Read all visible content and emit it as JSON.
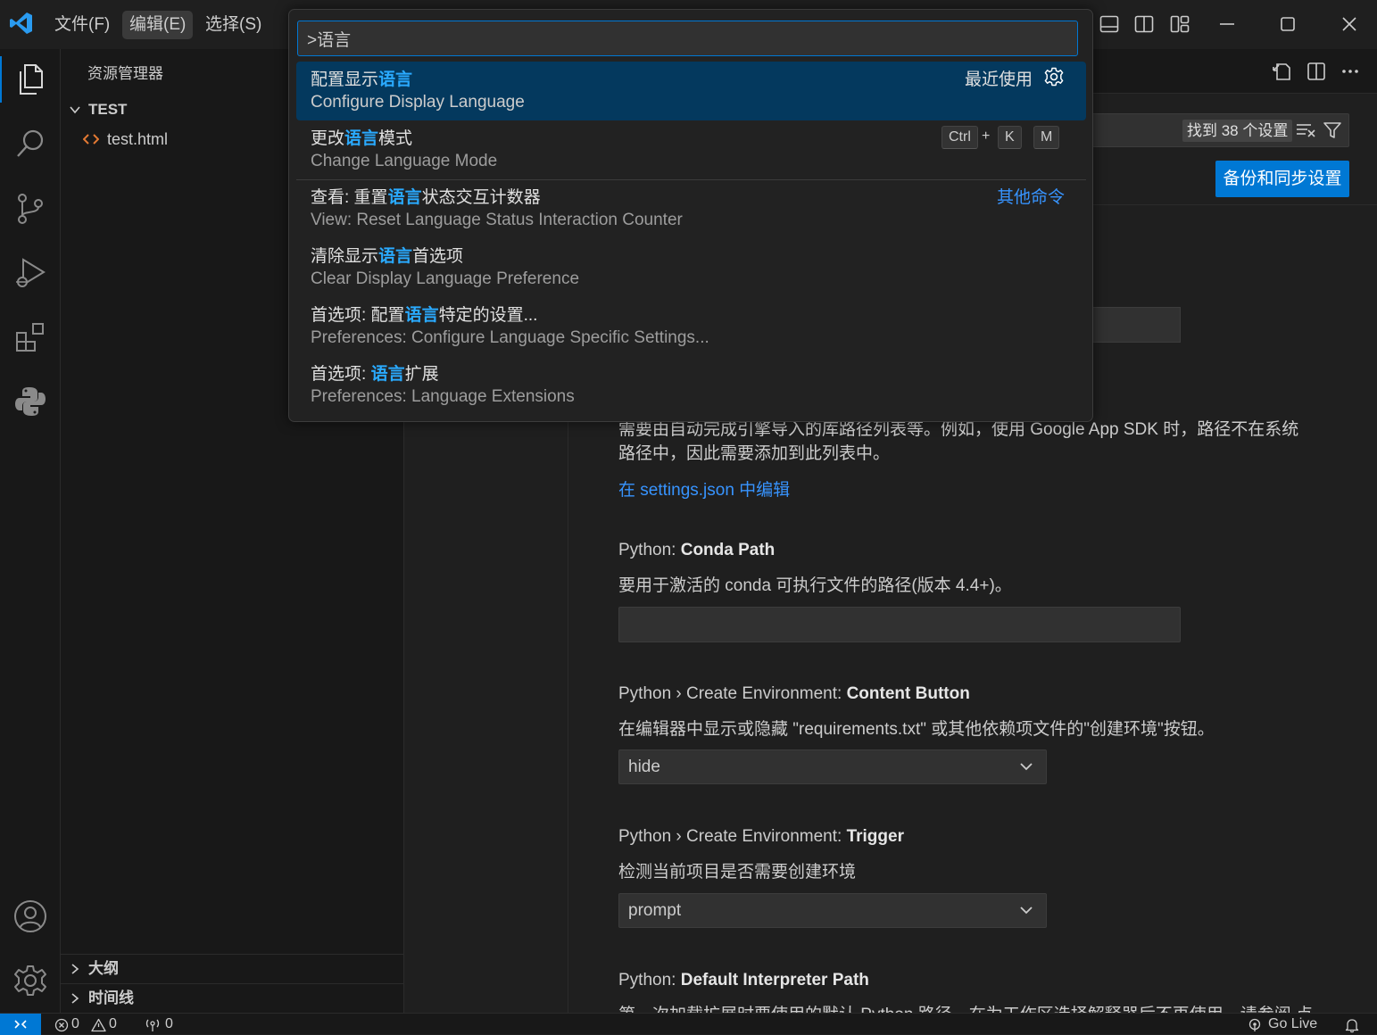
{
  "titlebar": {
    "menu": [
      "文件(F)",
      "编辑(E)",
      "选择(S)"
    ],
    "window_controls": [
      "minimize-icon",
      "maximize-icon",
      "close-icon"
    ],
    "layout_icons": [
      "toggle-panel-icon",
      "toggle-sidebar-icon",
      "customize-layout-icon"
    ]
  },
  "activity_bar": [
    "explorer-icon",
    "search-icon",
    "source-control-icon",
    "run-debug-icon",
    "extensions-icon",
    "python-icon",
    "account-icon",
    "manage-gear-icon"
  ],
  "sidebar": {
    "title": "资源管理器",
    "folder": "TEST",
    "files": [
      {
        "name": "test.html",
        "icon": "html-file-icon"
      }
    ],
    "panels": [
      "大纲",
      "时间线"
    ]
  },
  "palette": {
    "input_value": ">语言",
    "items": [
      {
        "label_pre": "配置显示",
        "label_hl": "语言",
        "label_post": "",
        "detail": "Configure Display Language",
        "right_text": "最近使用"
      },
      {
        "label_pre": "更改",
        "label_hl": "语言",
        "label_post": "模式",
        "detail": "Change Language Mode",
        "keys": [
          "Ctrl",
          "+",
          "K",
          "M"
        ]
      },
      {
        "label_pre": "查看: 重置",
        "label_hl": "语言",
        "label_post": "状态交互计数器",
        "detail": "View: Reset Language Status Interaction Counter",
        "right_text": "其他命令"
      },
      {
        "label_pre": "清除显示",
        "label_hl": "语言",
        "label_post": "首选项",
        "detail": "Clear Display Language Preference"
      },
      {
        "label_pre": "首选项: 配置",
        "label_hl": "语言",
        "label_post": "特定的设置...",
        "detail": "Preferences: Configure Language Specific Settings..."
      },
      {
        "label_pre": "首选项: ",
        "label_hl": "语言",
        "label_post": "扩展",
        "detail": "Preferences: Language Extensions"
      }
    ]
  },
  "settings": {
    "found_badge": "找到 38 个设置",
    "sync_button": "备份和同步设置",
    "extra_paths_desc_1": "需要由自动完成引擎导入的库路径列表等。例如，使用 Google App SDK 时，路径不在系统",
    "extra_paths_desc_2": "路径中，因此需要添加到此列表中。",
    "edit_json_link": "在 settings.json 中编辑",
    "conda_path": {
      "prefix": "Python: ",
      "name": "Conda Path",
      "desc": "要用于激活的 conda 可执行文件的路径(版本 4.4+)。"
    },
    "create_env_button": {
      "prefix": "Python › Create Environment: ",
      "name": "Content Button",
      "desc": "在编辑器中显示或隐藏 \"requirements.txt\" 或其他依赖项文件的\"创建环境\"按钮。",
      "value": "hide"
    },
    "create_env_trigger": {
      "prefix": "Python › Create Environment: ",
      "name": "Trigger",
      "desc": "检测当前项目是否需要创建环境",
      "value": "prompt"
    },
    "default_interpreter": {
      "prefix": "Python: ",
      "name": "Default Interpreter Path",
      "desc_partial": "第一次加载扩展时要使用的默认 Python 路径，在为工作区选择解释器后不再使用。请参阅 点"
    }
  },
  "statusbar": {
    "errors": "0",
    "warnings": "0",
    "ports": "0",
    "go_live": "Go Live"
  },
  "colors": {
    "accent": "#0078d4",
    "highlight": "#2aaaff",
    "selected_item": "#04395e",
    "link": "#3794ff"
  }
}
